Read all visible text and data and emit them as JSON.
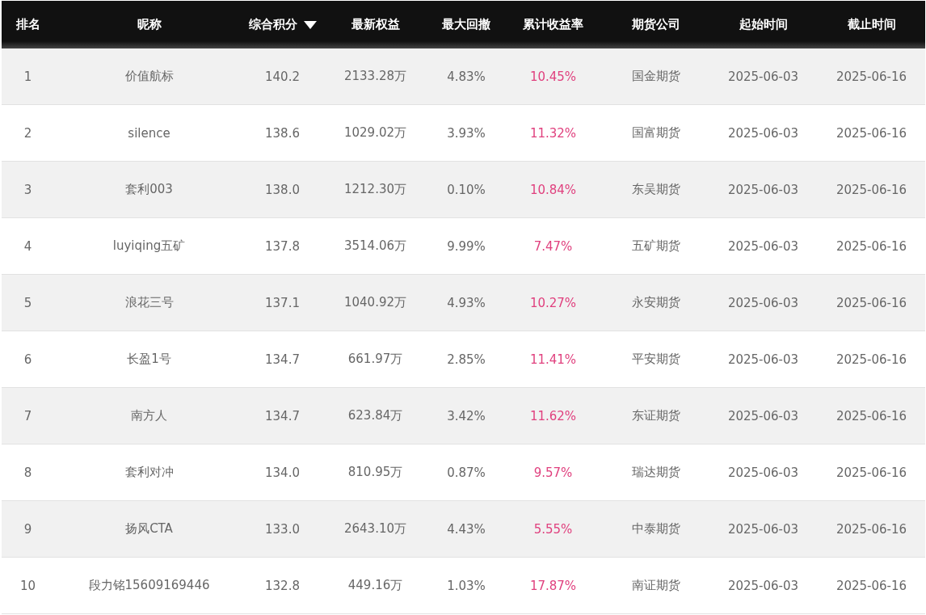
{
  "table": {
    "columns": [
      {
        "label": "排名",
        "sorted": false,
        "kind": "plain"
      },
      {
        "label": "昵称",
        "sorted": false,
        "kind": "plain"
      },
      {
        "label": "综合积分",
        "sorted": true,
        "kind": "plain"
      },
      {
        "label": "最新权益",
        "sorted": false,
        "kind": "plain"
      },
      {
        "label": "最大回撤",
        "sorted": false,
        "kind": "plain"
      },
      {
        "label": "累计收益率",
        "sorted": false,
        "kind": "return"
      },
      {
        "label": "期货公司",
        "sorted": false,
        "kind": "plain"
      },
      {
        "label": "起始时间",
        "sorted": false,
        "kind": "plain"
      },
      {
        "label": "截止时间",
        "sorted": false,
        "kind": "plain"
      }
    ],
    "rows": [
      [
        "1",
        "价值航标",
        "140.2",
        "2133.28万",
        "4.83%",
        "10.45%",
        "国金期货",
        "2025-06-03",
        "2025-06-16"
      ],
      [
        "2",
        "silence",
        "138.6",
        "1029.02万",
        "3.93%",
        "11.32%",
        "国富期货",
        "2025-06-03",
        "2025-06-16"
      ],
      [
        "3",
        "套利003",
        "138.0",
        "1212.30万",
        "0.10%",
        "10.84%",
        "东吴期货",
        "2025-06-03",
        "2025-06-16"
      ],
      [
        "4",
        "luyiqing五矿",
        "137.8",
        "3514.06万",
        "9.99%",
        "7.47%",
        "五矿期货",
        "2025-06-03",
        "2025-06-16"
      ],
      [
        "5",
        "浪花三号",
        "137.1",
        "1040.92万",
        "4.93%",
        "10.27%",
        "永安期货",
        "2025-06-03",
        "2025-06-16"
      ],
      [
        "6",
        "长盈1号",
        "134.7",
        "661.97万",
        "2.85%",
        "11.41%",
        "平安期货",
        "2025-06-03",
        "2025-06-16"
      ],
      [
        "7",
        "南方人",
        "134.7",
        "623.84万",
        "3.42%",
        "11.62%",
        "东证期货",
        "2025-06-03",
        "2025-06-16"
      ],
      [
        "8",
        "套利对冲",
        "134.0",
        "810.95万",
        "0.87%",
        "9.57%",
        "瑞达期货",
        "2025-06-03",
        "2025-06-16"
      ],
      [
        "9",
        "扬风CTA",
        "133.0",
        "2643.10万",
        "4.43%",
        "5.55%",
        "中泰期货",
        "2025-06-03",
        "2025-06-16"
      ],
      [
        "10",
        "段力铭15609169446",
        "132.8",
        "449.16万",
        "1.03%",
        "17.87%",
        "南证期货",
        "2025-06-03",
        "2025-06-16"
      ]
    ]
  }
}
